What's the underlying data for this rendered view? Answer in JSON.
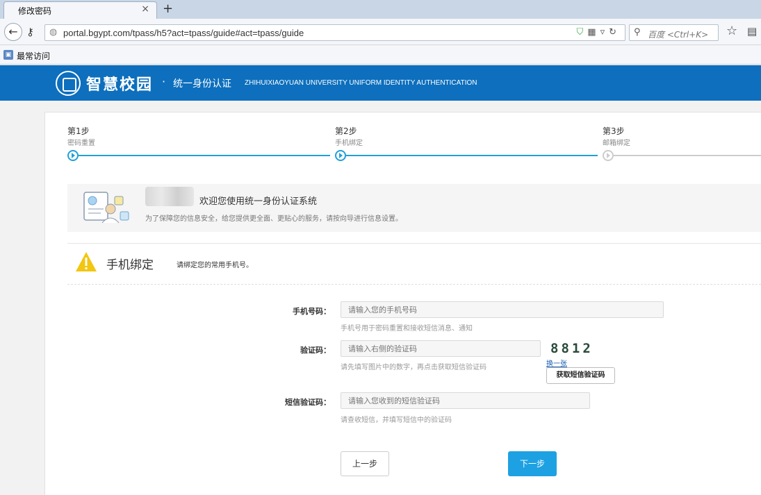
{
  "browser": {
    "tab_title": "修改密码",
    "tab_close": "×",
    "new_tab": "+",
    "url": "portal.bgypt.com/tpass/h5?act=tpass/guide#act=tpass/guide",
    "search_placeholder": "百度 <Ctrl+K>",
    "bookmark_label": "最常访问"
  },
  "header": {
    "brand": "智慧校园",
    "dot": "·",
    "subtitle": "统一身份认证",
    "english": "ZHIHUIXIAOYUAN UNIVERSITY UNIFORM IDENTITY AUTHENTICATION"
  },
  "steps": [
    {
      "label": "第1步",
      "sub": "密码重置",
      "active": true
    },
    {
      "label": "第2步",
      "sub": "手机绑定",
      "active": true
    },
    {
      "label": "第3步",
      "sub": "邮箱绑定",
      "active": false
    }
  ],
  "welcome": {
    "title": "欢迎您使用统一身份认证系统",
    "desc": "为了保障您的信息安全，给您提供更全面、更贴心的服务，请按向导进行信息设置。"
  },
  "section": {
    "title": "手机绑定",
    "hint": "请绑定您的常用手机号。"
  },
  "form": {
    "phone": {
      "label": "手机号码：",
      "placeholder": "请输入您的手机号码",
      "help": "手机号用于密码重置和接收短信消息、通知"
    },
    "captcha": {
      "label": "验证码：",
      "placeholder": "请输入右侧的验证码",
      "help": "请先填写图片中的数字，再点击获取短信验证码",
      "image_text": "8812",
      "refresh": "换一张",
      "sms_button": "获取短信验证码"
    },
    "sms": {
      "label": "短信验证码：",
      "placeholder": "请输入您收到的短信验证码",
      "help": "请查收短信，并填写短信中的验证码"
    }
  },
  "actions": {
    "prev": "上一步",
    "next": "下一步"
  }
}
